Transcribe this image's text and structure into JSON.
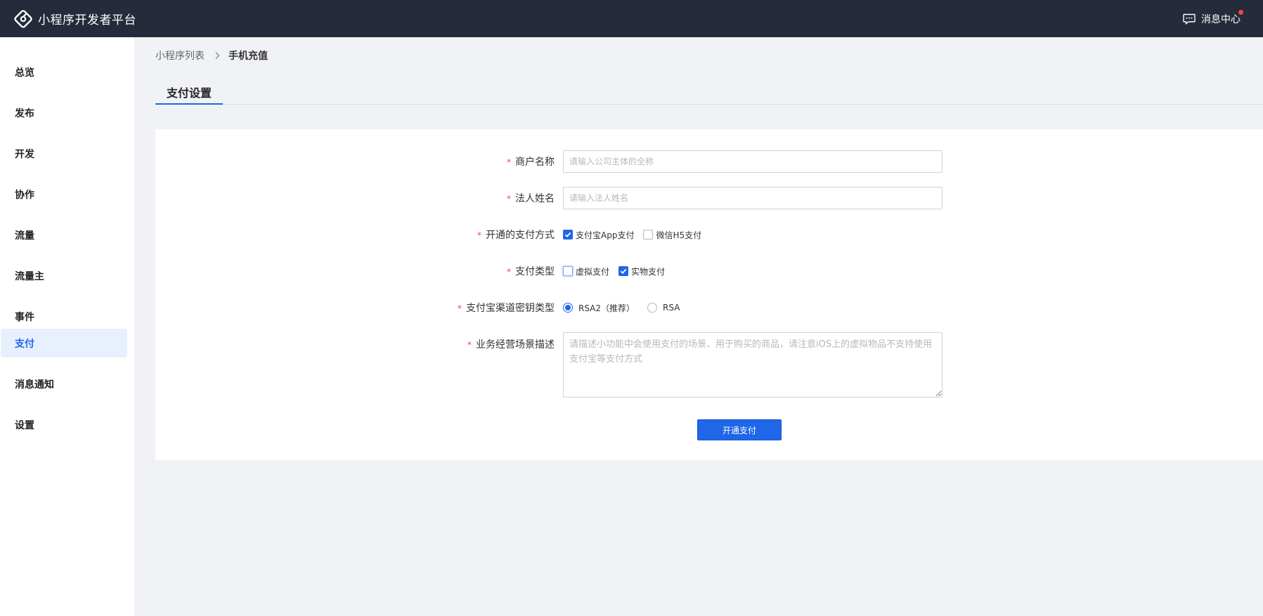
{
  "header": {
    "app_title": "小程序开发者平台",
    "logo_icon": "mini-program-logo-icon",
    "message_center_label": "消息中心",
    "message_icon": "message-chat-icon",
    "notification_dot_color": "#f5473e"
  },
  "sidebar": {
    "items": [
      {
        "label": "总览"
      },
      {
        "label": "发布"
      },
      {
        "label": "开发"
      },
      {
        "label": "协作"
      },
      {
        "label": "流量"
      },
      {
        "label": "流量主"
      },
      {
        "label": "事件"
      },
      {
        "label": "支付",
        "active": true
      },
      {
        "label": "消息通知"
      },
      {
        "label": "设置"
      }
    ]
  },
  "breadcrumb": {
    "parent": "小程序列表",
    "separator_icon": "chevron-right-icon",
    "current": "手机充值"
  },
  "tabs": [
    {
      "label": "支付设置",
      "active": true
    }
  ],
  "form": {
    "merchant_name": {
      "label": "商户名称",
      "placeholder": "请输入公司主体的全称",
      "value": ""
    },
    "legal_person": {
      "label": "法人姓名",
      "placeholder": "请输入法人姓名",
      "value": ""
    },
    "payment_methods": {
      "label": "开通的支付方式",
      "options": [
        {
          "label": "支付宝App支付",
          "checked": true
        },
        {
          "label": "微信H5支付",
          "checked": false
        }
      ]
    },
    "payment_type": {
      "label": "支付类型",
      "options": [
        {
          "label": "虚拟支付",
          "checked": false
        },
        {
          "label": "实物支付",
          "checked": true
        }
      ]
    },
    "key_type": {
      "label": "支付宝渠道密钥类型",
      "options": [
        {
          "label": "RSA2（推荐）",
          "selected": true
        },
        {
          "label": "RSA",
          "selected": false
        }
      ]
    },
    "business_desc": {
      "label": "业务经营场景描述",
      "placeholder": "请描述小功能中会使用支付的场景、用于购买的商品，请注意iOS上的虚拟物品不支持使用支付宝等支付方式",
      "value": ""
    },
    "required_mark": "*",
    "submit_label": "开通支付"
  },
  "colors": {
    "topbar_bg": "#252b3a",
    "accent": "#1f66e8",
    "required": "#f5473e",
    "page_bg": "#f0f2f5"
  }
}
